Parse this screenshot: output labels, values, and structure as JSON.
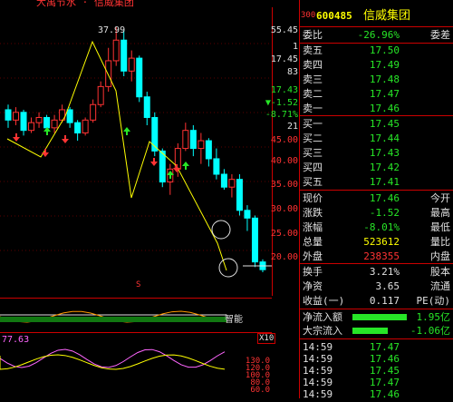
{
  "header": {
    "title": "大禹节水 · 信威集团",
    "code_prefix": "300",
    "code": "600485",
    "name": "信威集团"
  },
  "chart": {
    "peak_label": "37.99",
    "marker_s": "S",
    "axis_labels": [
      "55.45",
      "1",
      "17.45",
      "83",
      "17.43",
      "▼-1.52",
      "-8.71%",
      "21",
      "45.00",
      "40.00",
      "35.00",
      "30.00",
      "25.00",
      "20.00"
    ],
    "candles": [
      {
        "o": 48.5,
        "c": 46.5,
        "h": 49.5,
        "l": 45.0
      },
      {
        "o": 46.5,
        "c": 48.0,
        "h": 49.0,
        "l": 45.5
      },
      {
        "o": 48.0,
        "c": 44.5,
        "h": 48.5,
        "l": 43.5
      },
      {
        "o": 44.5,
        "c": 46.0,
        "h": 47.0,
        "l": 44.0
      },
      {
        "o": 46.0,
        "c": 47.0,
        "h": 48.0,
        "l": 45.0
      },
      {
        "o": 47.0,
        "c": 45.0,
        "h": 47.5,
        "l": 44.5
      },
      {
        "o": 45.0,
        "c": 46.5,
        "h": 47.5,
        "l": 44.0
      },
      {
        "o": 46.5,
        "c": 48.5,
        "h": 49.5,
        "l": 46.0
      },
      {
        "o": 48.5,
        "c": 46.0,
        "h": 49.0,
        "l": 45.0
      },
      {
        "o": 46.0,
        "c": 44.0,
        "h": 46.5,
        "l": 42.5
      },
      {
        "o": 44.0,
        "c": 46.5,
        "h": 47.0,
        "l": 43.5
      },
      {
        "o": 46.5,
        "c": 49.5,
        "h": 50.5,
        "l": 46.0
      },
      {
        "o": 49.5,
        "c": 53.0,
        "h": 54.0,
        "l": 49.0
      },
      {
        "o": 53.0,
        "c": 58.0,
        "h": 60.5,
        "l": 52.0
      },
      {
        "o": 58.0,
        "c": 62.0,
        "h": 64.5,
        "l": 57.0
      },
      {
        "o": 62.0,
        "c": 56.0,
        "h": 64.0,
        "l": 55.0
      },
      {
        "o": 56.0,
        "c": 58.5,
        "h": 60.0,
        "l": 54.0
      },
      {
        "o": 58.5,
        "c": 51.0,
        "h": 59.0,
        "l": 50.0
      },
      {
        "o": 51.0,
        "c": 47.0,
        "h": 52.0,
        "l": 45.5
      },
      {
        "o": 47.0,
        "c": 40.5,
        "h": 48.0,
        "l": 39.5
      },
      {
        "o": 40.5,
        "c": 34.5,
        "h": 41.0,
        "l": 33.5
      },
      {
        "o": 34.5,
        "c": 37.0,
        "h": 38.0,
        "l": 32.0
      },
      {
        "o": 37.0,
        "c": 41.0,
        "h": 42.0,
        "l": 35.5
      },
      {
        "o": 41.0,
        "c": 44.5,
        "h": 46.0,
        "l": 40.5
      },
      {
        "o": 44.5,
        "c": 41.0,
        "h": 45.5,
        "l": 39.5
      },
      {
        "o": 41.0,
        "c": 42.5,
        "h": 44.0,
        "l": 38.0
      },
      {
        "o": 42.5,
        "c": 39.0,
        "h": 43.0,
        "l": 37.5
      },
      {
        "o": 39.0,
        "c": 36.0,
        "h": 41.0,
        "l": 35.0
      },
      {
        "o": 36.0,
        "c": 33.5,
        "h": 37.0,
        "l": 33.0
      },
      {
        "o": 33.5,
        "c": 35.0,
        "h": 36.0,
        "l": 31.5
      },
      {
        "o": 35.0,
        "c": 29.0,
        "h": 36.0,
        "l": 28.0
      },
      {
        "o": 29.0,
        "c": 27.5,
        "h": 30.0,
        "l": 25.0
      },
      {
        "o": 27.5,
        "c": 19.0,
        "h": 28.0,
        "l": 18.0
      },
      {
        "o": 19.0,
        "c": 17.5,
        "h": 19.5,
        "l": 17.0
      }
    ]
  },
  "indicator1": {
    "title": "智能"
  },
  "indicator2": {
    "value": "77.63",
    "axis": [
      "130.0",
      "120.0",
      "100.0",
      "80.0",
      "60.0"
    ],
    "tag": "X10"
  },
  "quote": {
    "webi_label": "委比",
    "webi_val": "-26.96%",
    "webi_diff": "委差",
    "asks": [
      {
        "label": "卖五",
        "price": "17.50",
        "vol": ""
      },
      {
        "label": "卖四",
        "price": "17.49",
        "vol": ""
      },
      {
        "label": "卖三",
        "price": "17.48",
        "vol": ""
      },
      {
        "label": "卖二",
        "price": "17.47",
        "vol": ""
      },
      {
        "label": "卖一",
        "price": "17.46",
        "vol": ""
      }
    ],
    "bids": [
      {
        "label": "买一",
        "price": "17.45",
        "vol": ""
      },
      {
        "label": "买二",
        "price": "17.44",
        "vol": ""
      },
      {
        "label": "买三",
        "price": "17.43",
        "vol": ""
      },
      {
        "label": "买四",
        "price": "17.42",
        "vol": ""
      },
      {
        "label": "买五",
        "price": "17.41",
        "vol": ""
      }
    ],
    "stats": [
      {
        "label": "现价",
        "val": "17.46",
        "k2": "今开",
        "cls": "green"
      },
      {
        "label": "涨跌",
        "val": "-1.52",
        "k2": "最高",
        "cls": "green"
      },
      {
        "label": "涨幅",
        "val": "-8.01%",
        "k2": "最低",
        "cls": "green"
      },
      {
        "label": "总量",
        "val": "523612",
        "k2": "量比",
        "cls": "yellow"
      },
      {
        "label": "外盘",
        "val": "238355",
        "k2": "内盘",
        "cls": "red"
      }
    ],
    "stats2": [
      {
        "label": "换手",
        "val": "3.21%",
        "k2": "股本"
      },
      {
        "label": "净资",
        "val": "3.65",
        "k2": "流通"
      },
      {
        "label": "收益(一)",
        "val": "0.117",
        "k2": "PE(动)"
      }
    ],
    "flows": [
      {
        "label": "净流入额",
        "val": "1.95亿",
        "cls": "green",
        "fill": 0.85
      },
      {
        "label": "大宗流入",
        "val": "-1.06亿",
        "cls": "green",
        "fill": 0.55
      }
    ],
    "ticks": [
      {
        "time": "14:59",
        "price": "17.47"
      },
      {
        "time": "14:59",
        "price": "17.46"
      },
      {
        "time": "14:59",
        "price": "17.45"
      },
      {
        "time": "14:59",
        "price": "17.47"
      },
      {
        "time": "14:59",
        "price": "17.46"
      }
    ]
  }
}
